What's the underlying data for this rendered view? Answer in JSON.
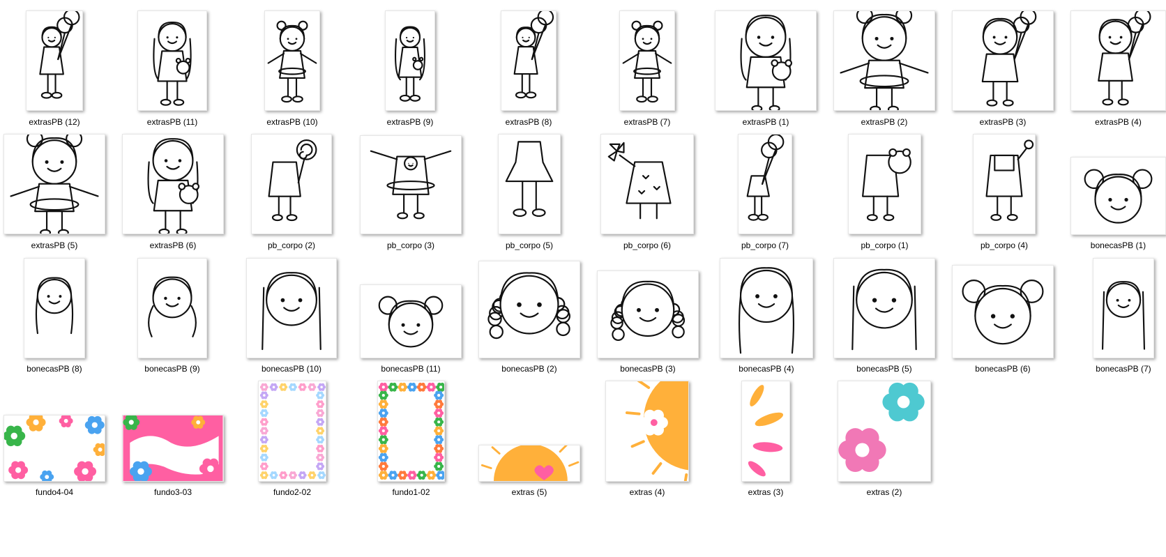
{
  "files": [
    {
      "name": "extrasPB (12)",
      "kind": "girl-balloon"
    },
    {
      "name": "extrasPB (11)",
      "kind": "girl-bear"
    },
    {
      "name": "extrasPB (10)",
      "kind": "girl-hoop"
    },
    {
      "name": "extrasPB (9)",
      "kind": "girl-bear"
    },
    {
      "name": "extrasPB (8)",
      "kind": "girl-balloon"
    },
    {
      "name": "extrasPB (7)",
      "kind": "girl-hoop"
    },
    {
      "name": "extrasPB (1)",
      "kind": "girl-bear"
    },
    {
      "name": "extrasPB (2)",
      "kind": "girl-hoop"
    },
    {
      "name": "extrasPB (3)",
      "kind": "girl-balloon"
    },
    {
      "name": "extrasPB (4)",
      "kind": "girl-balloon"
    },
    {
      "name": "extrasPB (5)",
      "kind": "girl-hoop"
    },
    {
      "name": "extrasPB (6)",
      "kind": "girl-bear"
    },
    {
      "name": "pb_corpo (2)",
      "kind": "body-lollipop"
    },
    {
      "name": "pb_corpo (3)",
      "kind": "body-hoop"
    },
    {
      "name": "pb_corpo (5)",
      "kind": "body-dress"
    },
    {
      "name": "pb_corpo (6)",
      "kind": "body-pinwheel"
    },
    {
      "name": "pb_corpo (7)",
      "kind": "body-balloon"
    },
    {
      "name": "pb_corpo (1)",
      "kind": "body-bear"
    },
    {
      "name": "pb_corpo (4)",
      "kind": "body-overall"
    },
    {
      "name": "bonecasPB (1)",
      "kind": "head-buns"
    },
    {
      "name": "bonecasPB (8)",
      "kind": "head-braids"
    },
    {
      "name": "bonecasPB (9)",
      "kind": "head-pigtails"
    },
    {
      "name": "bonecasPB (10)",
      "kind": "head-long"
    },
    {
      "name": "bonecasPB (11)",
      "kind": "head-buns"
    },
    {
      "name": "bonecasPB (2)",
      "kind": "head-curly"
    },
    {
      "name": "bonecasPB (3)",
      "kind": "head-curly"
    },
    {
      "name": "bonecasPB (4)",
      "kind": "head-braids"
    },
    {
      "name": "bonecasPB (5)",
      "kind": "head-long"
    },
    {
      "name": "bonecasPB (6)",
      "kind": "head-buns"
    },
    {
      "name": "bonecasPB (7)",
      "kind": "head-long"
    },
    {
      "name": "fundo4-04",
      "kind": "bg-flowers"
    },
    {
      "name": "fundo3-03",
      "kind": "bg-pink"
    },
    {
      "name": "fundo2-02",
      "kind": "bg-frame-pastel"
    },
    {
      "name": "fundo1-02",
      "kind": "bg-frame-bright"
    },
    {
      "name": "extras (5)",
      "kind": "sun-heart"
    },
    {
      "name": "extras (4)",
      "kind": "sun-flower"
    },
    {
      "name": "extras (3)",
      "kind": "strokes"
    },
    {
      "name": "extras (2)",
      "kind": "two-flowers"
    }
  ],
  "colors": {
    "label": "#000000",
    "yellow": "#ffb03a",
    "pink": "#ff5fa2",
    "teal": "#4ec9d1",
    "green": "#38b54a",
    "blue": "#4aa3f0"
  }
}
